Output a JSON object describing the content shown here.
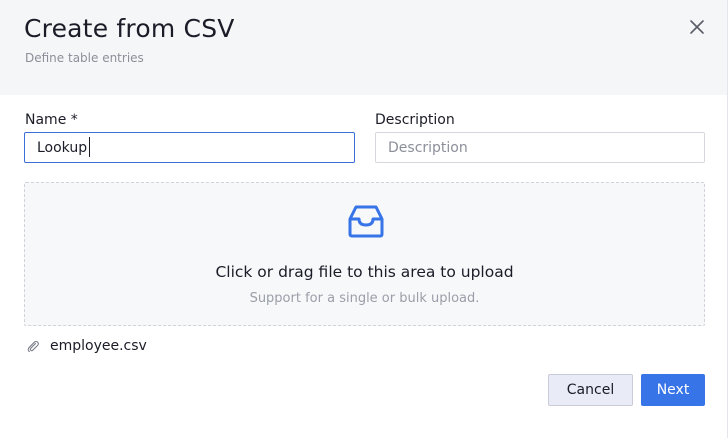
{
  "dialog": {
    "title": "Create from CSV",
    "subtitle": "Define table entries",
    "close_icon": "close-icon"
  },
  "form": {
    "name": {
      "label": "Name *",
      "value": "Lookup",
      "placeholder": ""
    },
    "description": {
      "label": "Description",
      "value": "",
      "placeholder": "Description"
    }
  },
  "upload": {
    "icon": "inbox-icon",
    "icon_color": "#3774e8",
    "text": "Click or drag file to this area to upload",
    "hint": "Support for a single or bulk upload."
  },
  "files": [
    {
      "icon": "paperclip-icon",
      "name": "employee.csv"
    }
  ],
  "footer": {
    "cancel_label": "Cancel",
    "next_label": "Next",
    "primary_color": "#3774e8"
  }
}
